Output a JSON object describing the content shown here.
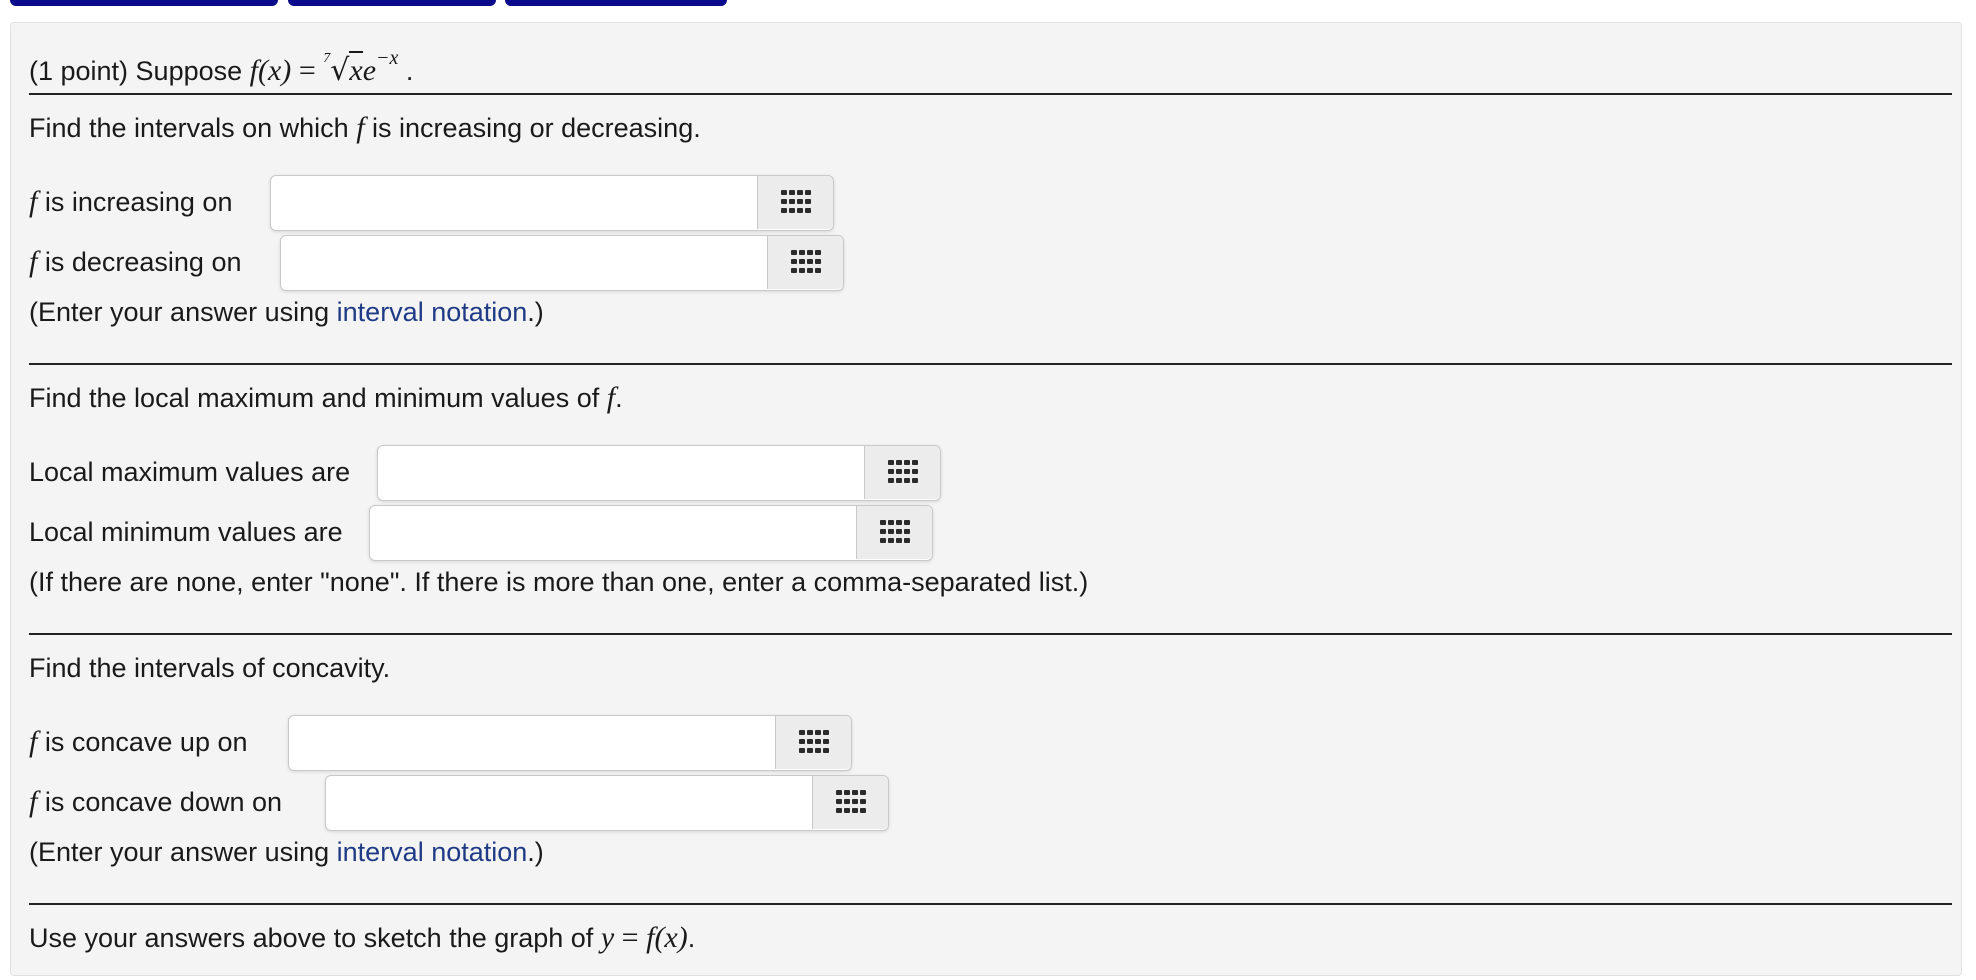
{
  "header": {
    "points": "(1 point) Suppose",
    "function_lhs": "f(x)",
    "equals": "=",
    "root_index": "7",
    "radicand": "x",
    "base": "e",
    "exponent": "−x",
    "end": "."
  },
  "section1": {
    "intro_prefix": "Find the intervals on which",
    "intro_symbol": "f",
    "intro_suffix": "is increasing or decreasing.",
    "increasing": {
      "symbol": "f",
      "label": "is increasing on",
      "value": "",
      "placeholder": ""
    },
    "decreasing": {
      "symbol": "f",
      "label": "is decreasing on",
      "value": "",
      "placeholder": ""
    },
    "note_prefix": "(Enter your answer using",
    "note_link": "interval notation",
    "note_suffix": ".)"
  },
  "section2": {
    "intro_prefix": "Find the local maximum and minimum values of",
    "intro_symbol": "f",
    "intro_suffix": ".",
    "local_max": {
      "label": "Local maximum values are",
      "value": "",
      "placeholder": ""
    },
    "local_min": {
      "label": "Local minimum values are",
      "value": "",
      "placeholder": ""
    },
    "note": "(If there are none, enter \"none\". If there is more than one, enter a comma-separated list.)"
  },
  "section3": {
    "intro": "Find the intervals of concavity.",
    "concave_up": {
      "symbol": "f",
      "label": "is concave up on",
      "value": "",
      "placeholder": ""
    },
    "concave_down": {
      "symbol": "f",
      "label": "is concave down on",
      "value": "",
      "placeholder": ""
    },
    "note_prefix": "(Enter your answer using",
    "note_link": "interval notation",
    "note_suffix": ".)"
  },
  "section4": {
    "prefix": "Use your answers above to sketch the graph of",
    "y": "y",
    "equals": "=",
    "rhs": "f(x)",
    "end": "."
  },
  "icons": {
    "palette_button": "equation-palette-icon"
  },
  "colors": {
    "link": "#1f3b86",
    "top_buttons": "#0a0a8c",
    "panel": "#f4f4f4"
  }
}
